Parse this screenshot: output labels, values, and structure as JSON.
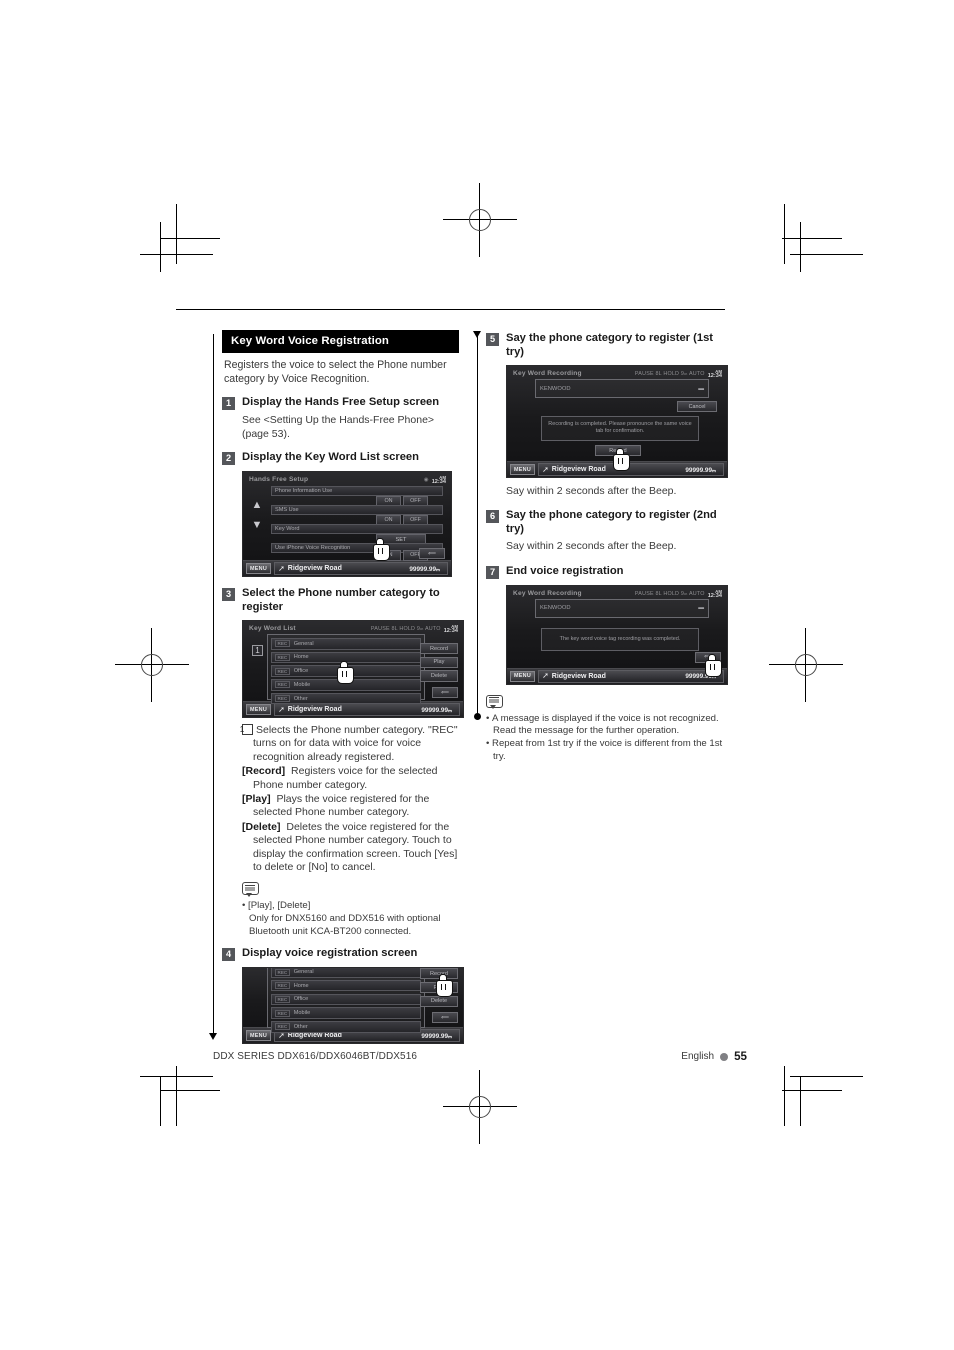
{
  "document": {
    "footer_left": "DDX SERIES  DDX616/DDX6046BT/DDX516",
    "footer_language": "English",
    "footer_page": "55"
  },
  "left_column": {
    "section_title": "Key Word Voice Registration",
    "intro": "Registers the voice to select the Phone number category by Voice Recognition.",
    "steps": [
      {
        "num": "1",
        "title": "Display the Hands Free Setup screen",
        "body": "See <Setting Up the Hands-Free Phone> (page 53)."
      },
      {
        "num": "2",
        "title": "Display the Key Word List screen"
      },
      {
        "num": "3",
        "title": "Select the Phone number category to register"
      },
      {
        "num": "4",
        "title": "Display voice registration screen"
      }
    ],
    "definitions": [
      {
        "marker": "1",
        "label": "",
        "text": "Selects the Phone number category. \"REC\" turns on for data with voice for voice recognition already registered."
      },
      {
        "marker": "",
        "label": "[Record]",
        "text": "Registers voice for the selected Phone number category."
      },
      {
        "marker": "",
        "label": "[Play]",
        "text": "Plays the voice registered for the selected Phone number category."
      },
      {
        "marker": "",
        "label": "[Delete]",
        "text": "Deletes the voice registered for the selected Phone number category. Touch to display the confirmation screen. Touch [Yes] to delete or [No] to cancel."
      }
    ],
    "note": {
      "items": [
        {
          "main": "[Play], [Delete]",
          "sub": "Only for DNX5160 and DDX516 with optional Bluetooth unit KCA-BT200 connected."
        }
      ]
    }
  },
  "right_column": {
    "steps": [
      {
        "num": "5",
        "title": "Say the phone category to register (1st try)",
        "body": "Say within 2 seconds after the Beep."
      },
      {
        "num": "6",
        "title": "Say the phone category to register (2nd try)",
        "body": "Say within 2 seconds after the Beep."
      },
      {
        "num": "7",
        "title": "End voice registration"
      }
    ],
    "note": {
      "items": [
        {
          "main": "A message is displayed if the voice is not recognized.",
          "sub": "Read the message for the further operation."
        },
        {
          "main": "Repeat from 1st try if the voice is different from the 1st",
          "sub": "try."
        }
      ]
    }
  },
  "screens": {
    "hands_free_setup": {
      "title": "Hands Free Setup",
      "status_icons": "",
      "clock_ampm": "AM",
      "clock_time": "12:34",
      "rows": [
        {
          "label": "Phone Information Use",
          "control": "onoff",
          "on": "ON",
          "off": "OFF"
        },
        {
          "label": "SMS Use",
          "control": "onoff",
          "on": "ON",
          "off": "OFF"
        },
        {
          "label": "Key Word",
          "control": "set",
          "set": "SET"
        },
        {
          "label": "Use iPhone Voice Recognition",
          "control": "onoff",
          "on": "ON",
          "off": "OFF"
        }
      ],
      "menu_label": "MENU",
      "road_name": "Ridgeview Road",
      "distance": "99999.99ₘ"
    },
    "key_word_list": {
      "title": "Key Word List",
      "status_icons": "PAUSE 8L HOLD 9ₘ   AUTO",
      "clock_ampm": "AM",
      "clock_time": "12:34",
      "rec_label": "REC",
      "categories": [
        "General",
        "Home",
        "Office",
        "Mobile",
        "Other"
      ],
      "buttons": [
        "Record",
        "Play",
        "Delete"
      ],
      "menu_label": "MENU",
      "road_name": "Ridgeview Road",
      "distance": "99999.99ₘ"
    },
    "voice_registration": {
      "rec_label": "REC",
      "categories": [
        "General",
        "Home",
        "Office",
        "Mobile",
        "Other"
      ],
      "buttons": [
        "Record",
        "Play",
        "Delete"
      ],
      "menu_label": "MENU",
      "road_name": "Ridgeview Road",
      "distance": "99999.99ₘ"
    },
    "key_word_recording_1": {
      "title": "Key Word Recording",
      "status_icons": "PAUSE 8L HOLD 9ₘ   AUTO",
      "clock_ampm": "AM",
      "clock_time": "12:34",
      "field_value": "KENWOOD",
      "cancel_label": "Cancel",
      "message": "Recording is completed. Please pronounce the same voice tab for confirmation.",
      "record_label": "Record",
      "menu_label": "MENU",
      "road_name": "Ridgeview Road",
      "distance": "99999.99ₘ"
    },
    "key_word_recording_2": {
      "title": "Key Word Recording",
      "status_icons": "PAUSE 8L HOLD 9ₘ   AUTO",
      "clock_ampm": "AM",
      "clock_time": "12:34",
      "field_value": "KENWOOD",
      "message": "The key word voice tag recording was completed.",
      "menu_label": "MENU",
      "road_name": "Ridgeview Road",
      "distance": "99999.99ₘ"
    }
  }
}
